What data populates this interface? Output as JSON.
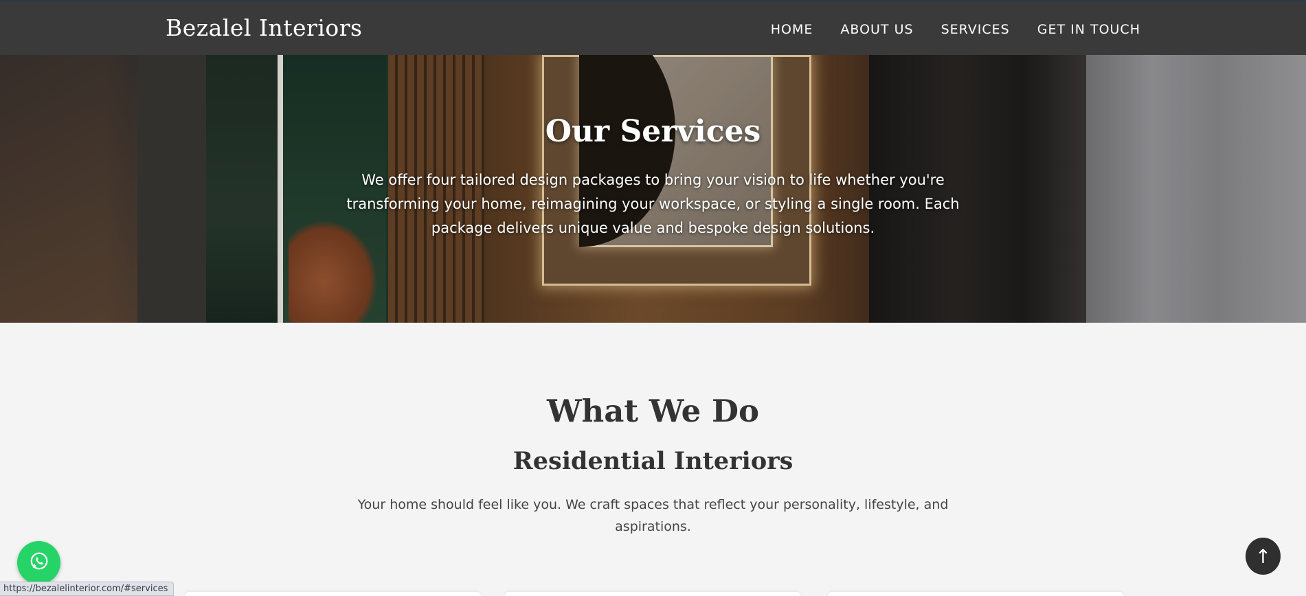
{
  "nav": {
    "brand": "Bezalel Interiors",
    "links": [
      "HOME",
      "ABOUT US",
      "SERVICES",
      "GET IN TOUCH"
    ]
  },
  "hero": {
    "title": "Our Services",
    "description": "We offer four tailored design packages to bring your vision to life whether you're transforming your home, reimagining your workspace, or styling a single room. Each package delivers unique value and bespoke design solutions."
  },
  "what_we_do": {
    "title": "What We Do",
    "subtitle": "Residential Interiors",
    "description": "Your home should feel like you. We craft spaces that reflect your personality, lifestyle, and aspirations."
  },
  "floating": {
    "whatsapp_icon": "whatsapp-icon",
    "scroll_top_label": "↑"
  },
  "status_bar": {
    "url": "https://bezalelinterior.com/#services"
  },
  "colors": {
    "nav_bg": "#3a3a3a",
    "page_bg": "#f4f4f4",
    "whatsapp": "#25d366",
    "scroll_top": "#2f2f2f"
  }
}
